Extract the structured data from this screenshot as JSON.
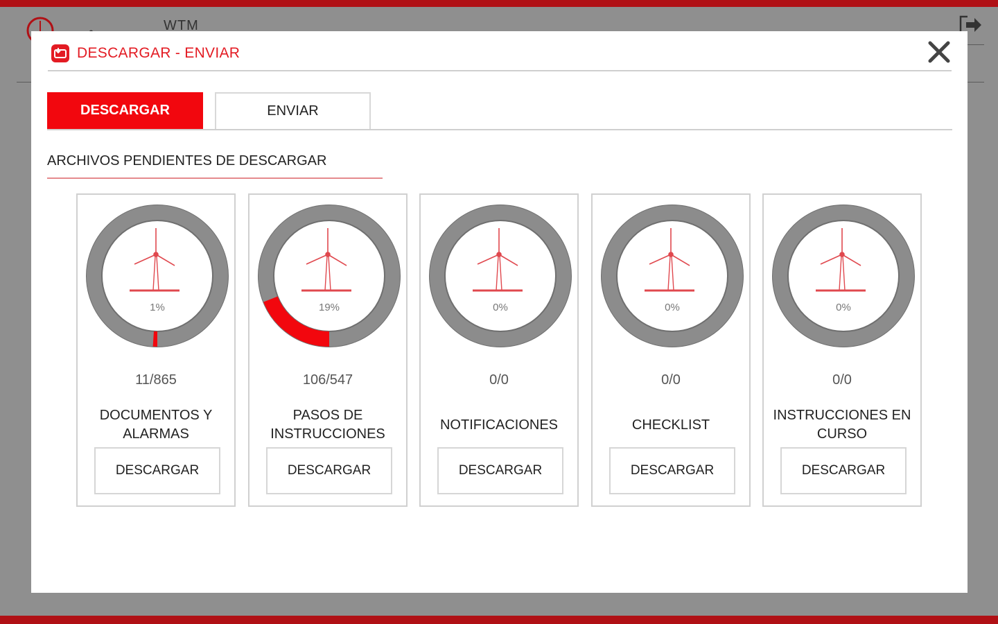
{
  "background": {
    "app_title": "WTM",
    "dot": "•"
  },
  "modal": {
    "title": "DESCARGAR - ENVIAR",
    "close_glyph": "✕"
  },
  "tabs": [
    {
      "label": "DESCARGAR",
      "active": true
    },
    {
      "label": "ENVIAR",
      "active": false
    }
  ],
  "section_title": "ARCHIVOS PENDIENTES DE DESCARGAR",
  "cards": [
    {
      "percent_label": "1%",
      "progress": 0.01,
      "count": "11/865",
      "label": "DOCUMENTOS Y ALARMAS",
      "button": "DESCARGAR"
    },
    {
      "percent_label": "19%",
      "progress": 0.19,
      "count": "106/547",
      "label": "PASOS DE INSTRUCCIONES",
      "button": "DESCARGAR"
    },
    {
      "percent_label": "0%",
      "progress": 0.0,
      "count": "0/0",
      "label": "NOTIFICACIONES",
      "button": "DESCARGAR"
    },
    {
      "percent_label": "0%",
      "progress": 0.0,
      "count": "0/0",
      "label": "CHECKLIST",
      "button": "DESCARGAR"
    },
    {
      "percent_label": "0%",
      "progress": 0.0,
      "count": "0/0",
      "label": "INSTRUCCIONES EN CURSO",
      "button": "DESCARGAR"
    }
  ],
  "colors": {
    "accent": "#f2070e",
    "ring": "#8c8c8c",
    "ring_dark": "#6f6f6f",
    "turbine": "#e0484e"
  },
  "icons": {
    "modal_icon": "download-send-icon",
    "close": "close-icon",
    "gauge_center": "wind-turbine-icon",
    "logout": "logout-icon"
  }
}
